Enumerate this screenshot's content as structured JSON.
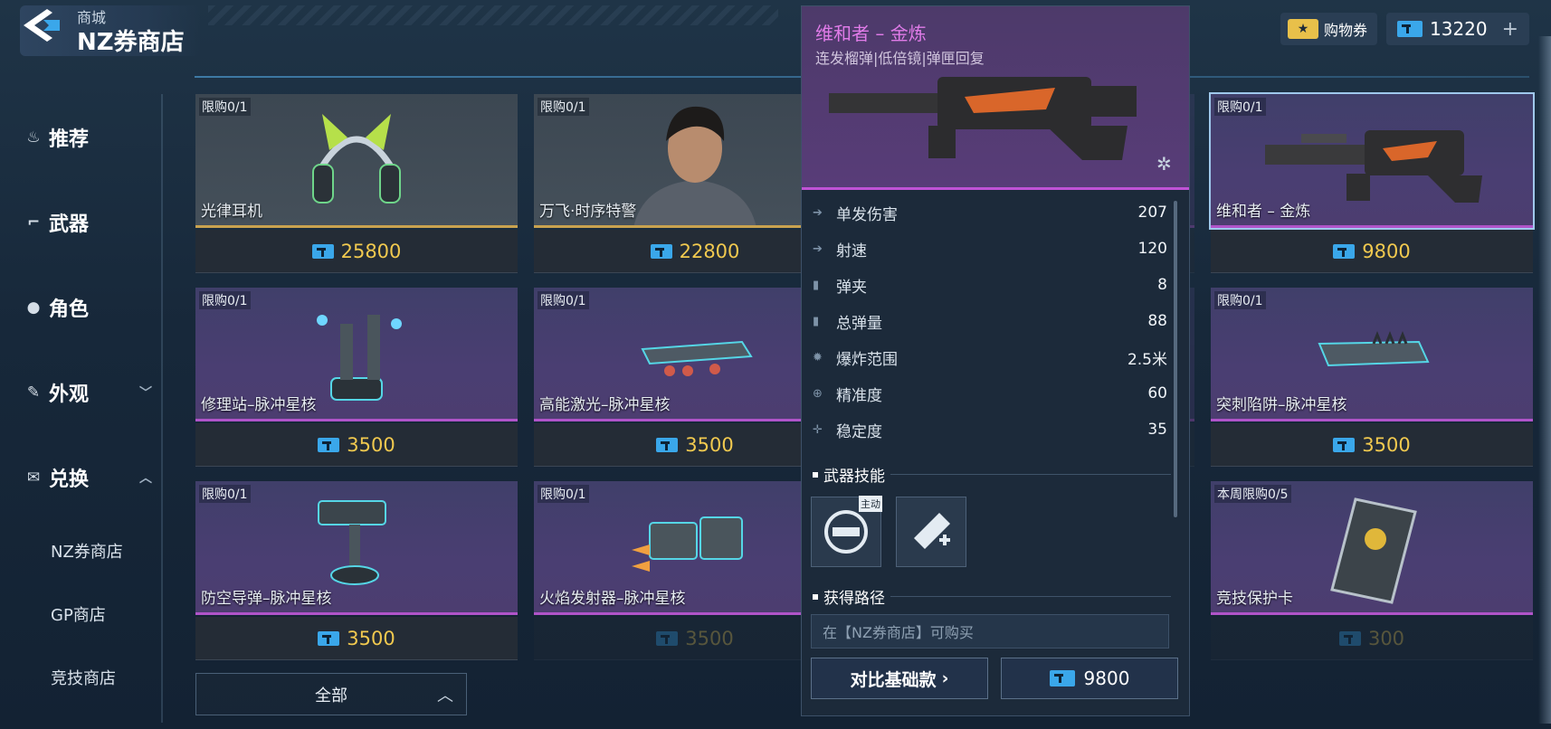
{
  "header": {
    "breadcrumb": "商城",
    "title": "NZ券商店",
    "voucher_label": "购物券",
    "nz_amount": "13220",
    "plus": "+"
  },
  "sidebar": {
    "items": [
      {
        "label": "推荐",
        "icon": "flame-icon"
      },
      {
        "label": "武器",
        "icon": "gun-icon"
      },
      {
        "label": "角色",
        "icon": "person-icon"
      },
      {
        "label": "外观",
        "icon": "spray-icon"
      },
      {
        "label": "兑换",
        "icon": "exchange-icon"
      }
    ],
    "subitems": [
      "NZ券商店",
      "GP商店",
      "竞技商店"
    ],
    "category_select": "全部"
  },
  "cards": [
    {
      "limit": "限购0/1",
      "name": "光律耳机",
      "price": "25800"
    },
    {
      "limit": "限购0/1",
      "name": "万飞·时序特警",
      "price": "22800"
    },
    {
      "limit": "",
      "name": "",
      "price": "9800"
    },
    {
      "limit": "限购0/1",
      "name": "维和者 – 金炼",
      "price": "9800"
    },
    {
      "limit": "限购0/1",
      "name": "修理站–脉冲星核",
      "price": "3500"
    },
    {
      "limit": "限购0/1",
      "name": "高能激光–脉冲星核",
      "price": "3500"
    },
    {
      "limit": "",
      "name": "",
      "price": "3500"
    },
    {
      "limit": "限购0/1",
      "name": "突刺陷阱–脉冲星核",
      "price": "3500"
    },
    {
      "limit": "限购0/1",
      "name": "防空导弹–脉冲星核",
      "price": "3500"
    },
    {
      "limit": "限购0/1",
      "name": "火焰发射器–脉冲星核",
      "price": "3500"
    },
    {
      "limit": "本周限购0/5",
      "name": "竞技保护卡",
      "price": "300"
    }
  ],
  "detail": {
    "title": "维和者 – 金炼",
    "subtitle": "连发榴弹|低倍镜|弹匣回复",
    "stats": [
      {
        "label": "单发伤害",
        "value": "207"
      },
      {
        "label": "射速",
        "value": "120"
      },
      {
        "label": "弹夹",
        "value": "8"
      },
      {
        "label": "总弹量",
        "value": "88"
      },
      {
        "label": "爆炸范围",
        "value": "2.5米"
      },
      {
        "label": "精准度",
        "value": "60"
      },
      {
        "label": "稳定度",
        "value": "35"
      }
    ],
    "skills_title": "武器技能",
    "skill_tag": "主动",
    "source_title": "获得路径",
    "source_text": "在【NZ券商店】可购买",
    "compare_label": "对比基础款",
    "compare_arrow": "›",
    "price": "9800"
  }
}
